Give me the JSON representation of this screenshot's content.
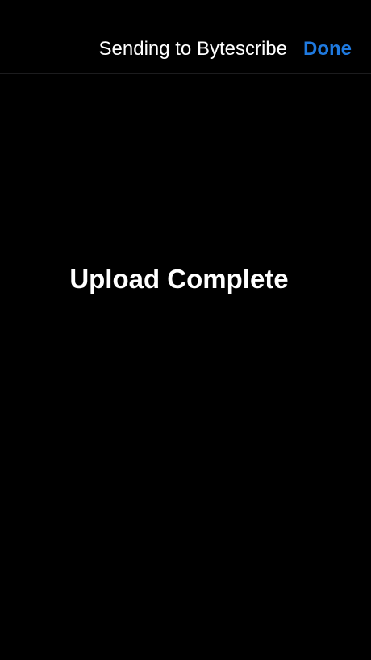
{
  "nav_bar": {
    "title": "Sending to Bytescribe",
    "done_label": "Done",
    "done_color": "#1f7ae0"
  },
  "content": {
    "status_message": "Upload Complete"
  }
}
